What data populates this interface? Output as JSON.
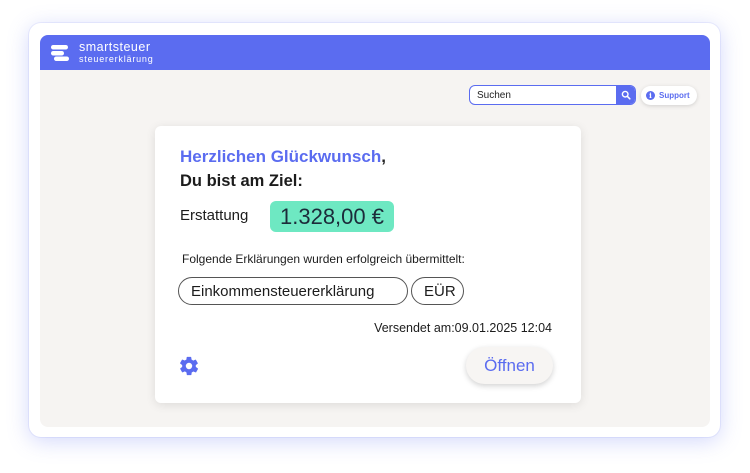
{
  "brand": {
    "name": "smartsteuer",
    "subtitle": "steuererklärung",
    "color": "#5b6cf0"
  },
  "search": {
    "placeholder": "Suchen",
    "button_icon": "search-icon"
  },
  "support": {
    "label": "Support",
    "icon": "info-icon"
  },
  "card": {
    "congrats": "Herzlichen Glückwunsch",
    "congrats_comma": ",",
    "goal": "Du bist am Ziel:",
    "refund_label": "Erstattung",
    "refund_amount": "1.328,00 €",
    "refund_color": "#6ee8c2",
    "submitted_text": "Folgende Erklärungen wurden erfolgreich übermittelt:",
    "declarations": [
      "Einkommensteuererklärung",
      "EÜR"
    ],
    "sent_label": "Versendet am:",
    "sent_datetime": "09.01.2025 12:04",
    "settings_icon": "gear-icon",
    "open_label": "Öffnen"
  }
}
